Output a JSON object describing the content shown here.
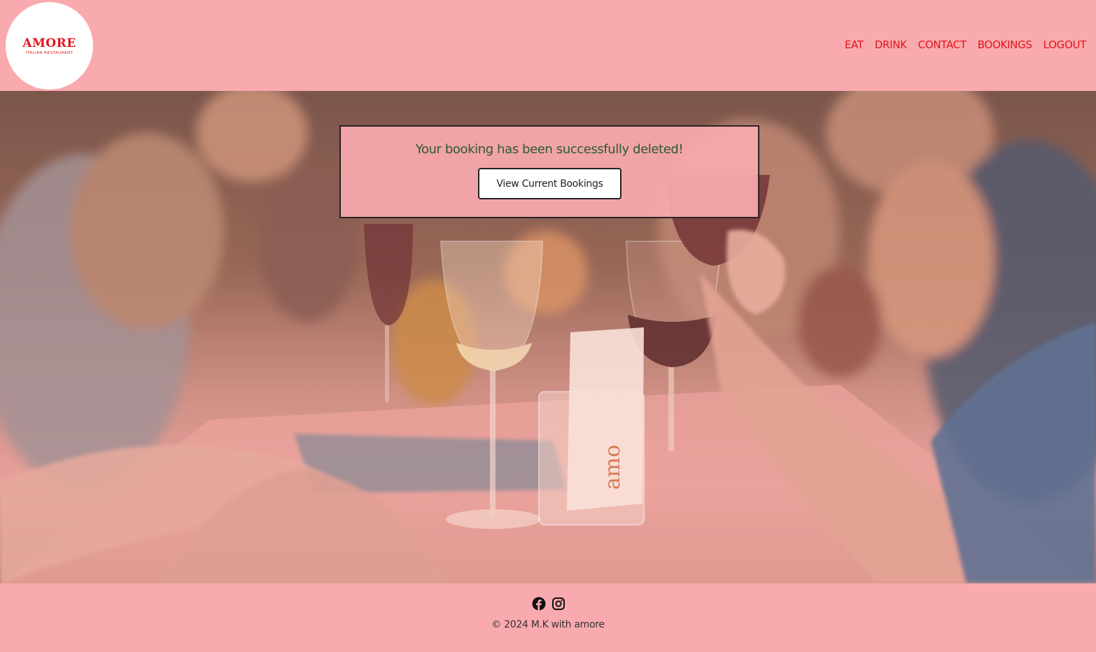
{
  "header": {
    "logo": {
      "name": "AMORE",
      "tagline": "ITALIAN RESTAURANT"
    },
    "nav": [
      {
        "label": "EAT"
      },
      {
        "label": "DRINK"
      },
      {
        "label": "CONTACT"
      },
      {
        "label": "BOOKINGS"
      },
      {
        "label": "LOGOUT"
      }
    ]
  },
  "main": {
    "message": "Your booking has been successfully deleted!",
    "view_bookings_label": "View Current Bookings"
  },
  "footer": {
    "icons": [
      "facebook-icon",
      "instagram-icon"
    ],
    "copyright": "© 2024 M.K with amore"
  },
  "colors": {
    "brand_red": "#e0151d",
    "background_pink": "#f9aaae",
    "message_green": "#2e5a2e"
  }
}
